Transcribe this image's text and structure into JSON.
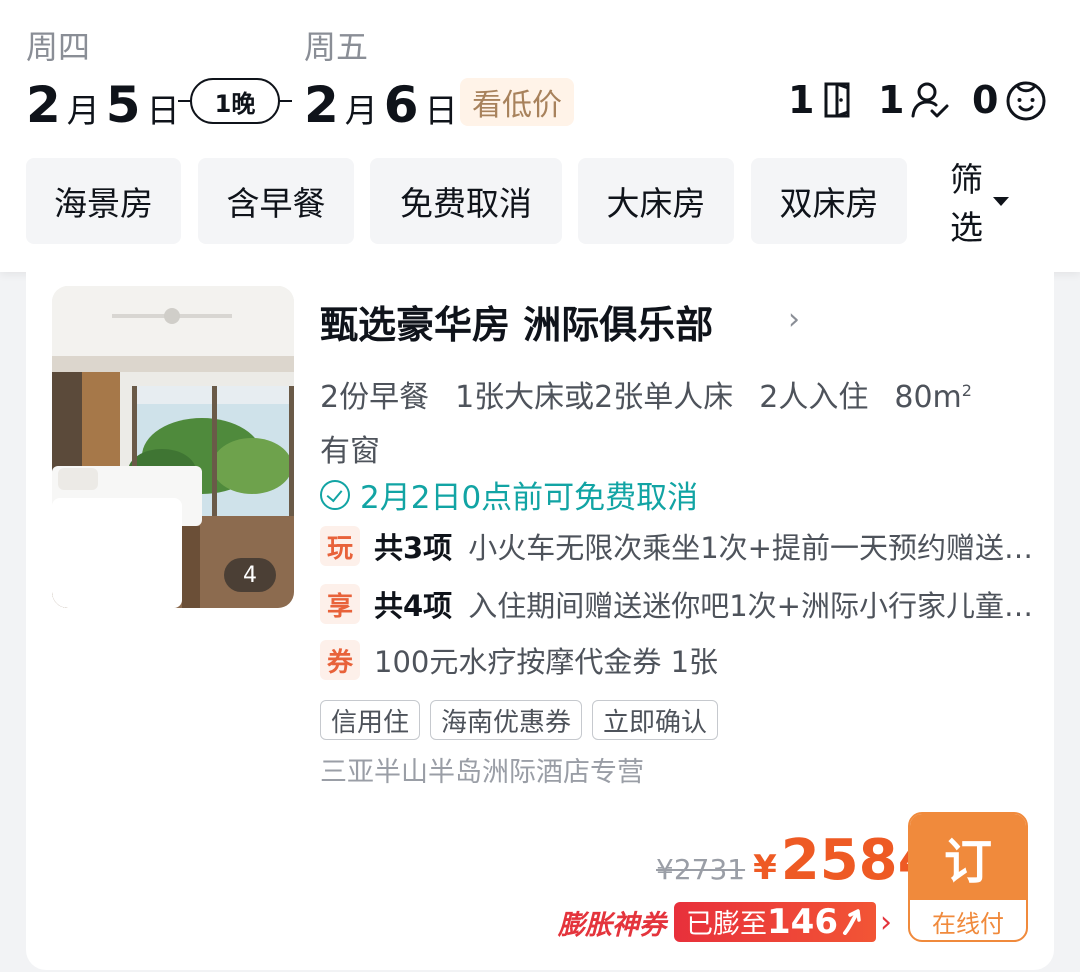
{
  "dates": {
    "checkin": {
      "weekday": "周四",
      "month": "2",
      "month_unit": "月",
      "day": "5",
      "day_unit": "日"
    },
    "checkout": {
      "weekday": "周五",
      "month": "2",
      "month_unit": "月",
      "day": "6",
      "day_unit": "日"
    },
    "nights": "1晚",
    "low_price_label": "看低价"
  },
  "occupancy": {
    "rooms": "1",
    "adults": "1",
    "children": "0"
  },
  "filters": [
    "海景房",
    "含早餐",
    "免费取消",
    "大床房",
    "双床房"
  ],
  "filter_button": "筛选",
  "room": {
    "photo_count": "4",
    "title": "甄选豪华房 洲际俱乐部",
    "breakfast": "2份早餐",
    "bed": "1张大床或2张单人床",
    "guests": "2人入住",
    "area": "80m",
    "area_sup": "2",
    "window": "有窗",
    "cancel_policy": "2月2日0点前可免费取消",
    "perks": [
      {
        "tag": "玩",
        "count": "共3项",
        "text": "小火车无限次乘坐1次+提前一天预约赠送…"
      },
      {
        "tag": "享",
        "count": "共4项",
        "text": "入住期间赠送迷你吧1次+洲际小行家儿童…"
      },
      {
        "tag": "券",
        "count": "",
        "text": "100元水疗按摩代金券 1张"
      }
    ],
    "tags": [
      "信用住",
      "海南优惠券",
      "立即确认"
    ],
    "store": "三亚半山半岛洲际酒店专营",
    "original_price": "¥2731",
    "currency": "¥",
    "price": "2584",
    "coupon_label": "膨胀神券",
    "coupon_prefix": "已膨至",
    "coupon_value": "146",
    "book_label": "订",
    "book_sub": "在线付"
  },
  "colors": {
    "accent": "#ee5a24",
    "teal": "#12a4a4",
    "book": "#f08a3c",
    "coupon": "#e4343c"
  }
}
